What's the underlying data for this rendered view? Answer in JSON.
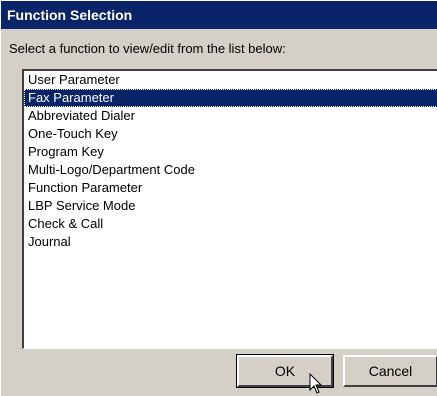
{
  "dialog": {
    "title": "Function Selection",
    "instruction": "Select a function to view/edit from the list below:"
  },
  "list": {
    "items": [
      "User Parameter",
      "Fax Parameter",
      "Abbreviated Dialer",
      "One-Touch Key",
      "Program Key",
      "Multi-Logo/Department Code",
      "Function Parameter",
      "LBP Service Mode",
      "Check & Call",
      "Journal"
    ],
    "selected": "Fax Parameter"
  },
  "buttons": {
    "ok_label": "OK",
    "cancel_label": "Cancel"
  },
  "cursor_icon": "arrow-cursor-icon",
  "colors": {
    "titlebar": "#0a246a",
    "selection": "#0a246a",
    "face": "#d4d0c8"
  }
}
